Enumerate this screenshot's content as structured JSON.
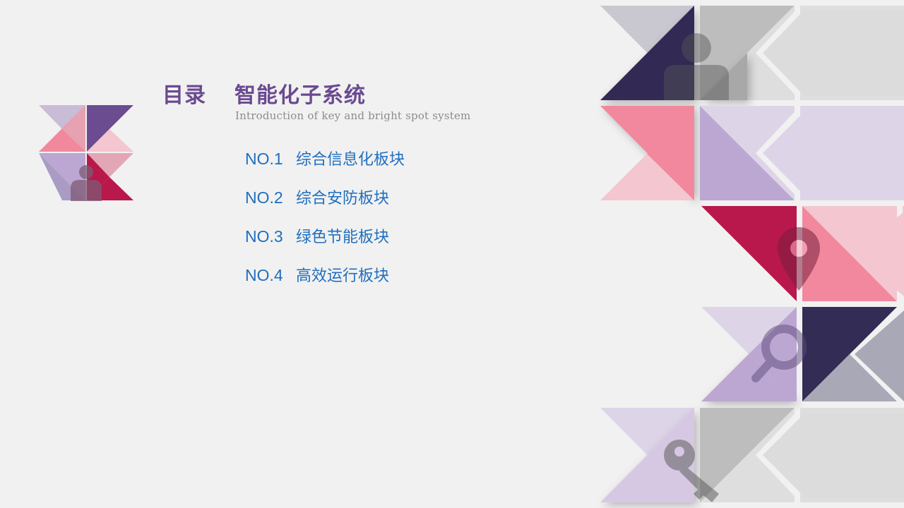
{
  "slide": {
    "label": "目录",
    "title": "智能化子系统",
    "subtitle": "Introduction of key and bright spot system"
  },
  "toc": [
    {
      "number": "NO.1",
      "label": "综合信息化板块"
    },
    {
      "number": "NO.2",
      "label": "综合安防板块"
    },
    {
      "number": "NO.3",
      "label": "绿色节能板块"
    },
    {
      "number": "NO.4",
      "label": "高效运行板块"
    }
  ],
  "palette": {
    "title": "#6a4a90",
    "toc_text": "#1f6fbf",
    "navy": "#332c55",
    "plum": "#6b4c91",
    "crimson": "#b8184b",
    "pink": "#f2889d",
    "light_pink": "#f3c6d0",
    "lavender": "#bca7d2",
    "light_lavender": "#ddd5e7",
    "gray": "#c9c8d1",
    "mid_gray": "#b8b8b8",
    "light_gray": "#dedede",
    "dark_gray": "#a9a8b6"
  },
  "icons": [
    "person-icon",
    "location-pin-icon",
    "magnifier-icon",
    "key-icon"
  ]
}
